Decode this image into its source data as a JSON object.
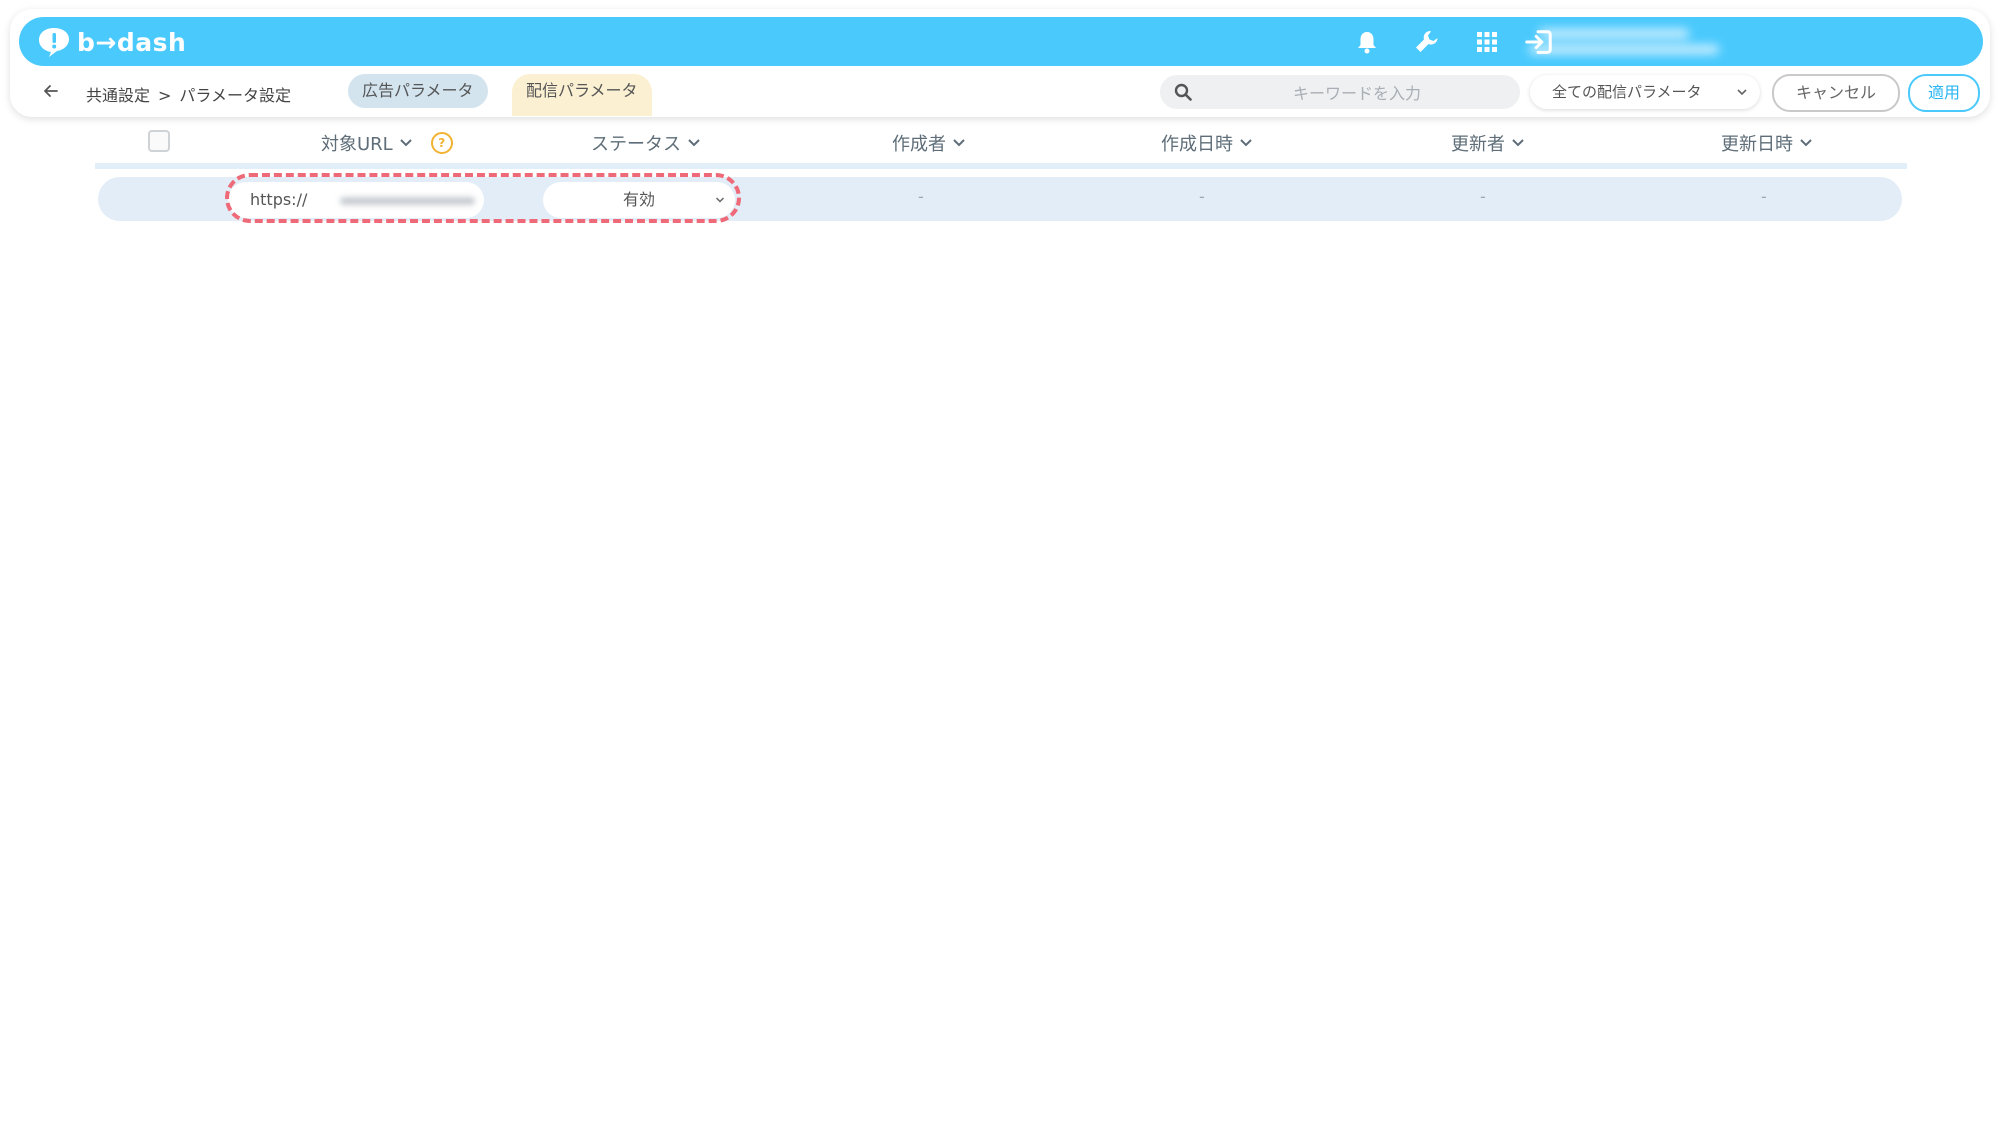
{
  "header": {
    "logo_text": "b→dash",
    "icons": [
      "bell-icon",
      "wrench-icon",
      "grid-icon",
      "logout-icon"
    ],
    "brand_color": "#4ac9fd"
  },
  "breadcrumb": {
    "parent": "共通設定",
    "separator": ">",
    "current": "パラメータ設定"
  },
  "tabs": [
    {
      "label": "広告パラメータ",
      "active": false
    },
    {
      "label": "配信パラメータ",
      "active": true
    }
  ],
  "search": {
    "placeholder": "キーワードを入力"
  },
  "filter": {
    "selected": "全ての配信パラメータ"
  },
  "actions": {
    "cancel_label": "キャンセル",
    "apply_label": "適用"
  },
  "table": {
    "columns": [
      "対象URL",
      "ステータス",
      "作成者",
      "作成日時",
      "更新者",
      "更新日時"
    ],
    "rows": [
      {
        "url_prefix": "https://",
        "status": "有効",
        "created_by": "-",
        "created_at": "-",
        "updated_by": "-",
        "updated_at": "-"
      }
    ]
  },
  "colors": {
    "highlight": "#ef6a78",
    "active_tab": "#fbf0d2",
    "inactive_tab": "#d3e4ef"
  }
}
